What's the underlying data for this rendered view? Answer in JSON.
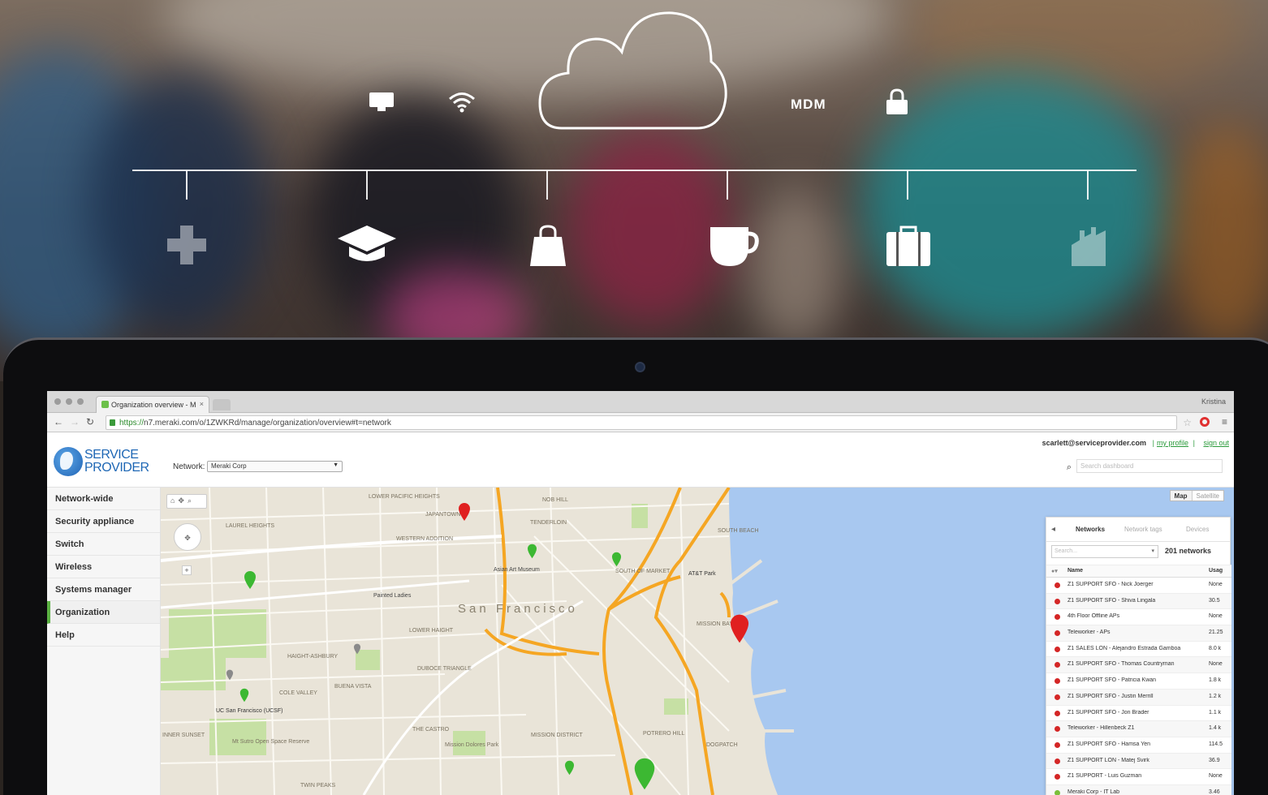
{
  "overlay": {
    "mdm_label": "MDM",
    "icons_top": [
      "monitor-icon",
      "wifi-icon",
      "cloud-icon",
      "mdm-label",
      "lock-icon"
    ],
    "icons_bottom": [
      "medical-cross-icon",
      "graduation-cap-icon",
      "shopping-bag-icon",
      "coffee-cup-icon",
      "briefcase-icon",
      "factory-icon"
    ]
  },
  "browser": {
    "tab_title": "Organization overview - M",
    "tab_close": "×",
    "window_user": "Kristina",
    "url_scheme": "https://",
    "url_rest": "n7.meraki.com/o/1ZWKRd/manage/organization/overview#t=network"
  },
  "app": {
    "brand_line1": "SERVICE",
    "brand_line2": "PROVIDER",
    "network_label": "Network:",
    "network_value": "Meraki Corp",
    "user_email": "scarlett@serviceprovider.com",
    "my_profile": "my profile",
    "sign_out": "sign out",
    "search_placeholder": "Search dashboard"
  },
  "nav": {
    "items": [
      "Network-wide",
      "Security appliance",
      "Switch",
      "Wireless",
      "Systems manager",
      "Organization",
      "Help"
    ],
    "active": "Organization"
  },
  "map": {
    "map_btn": "Map",
    "satellite_btn": "Satellite",
    "city_label": "San Francisco",
    "labels": {
      "lower_pacific_heights": "LOWER PACIFIC HEIGHTS",
      "japantown": "JAPANTOWN",
      "tenderloin": "TENDERLOIN",
      "laurel_heights": "LAUREL HEIGHTS",
      "western_addition": "WESTERN ADDITION",
      "south_of_market": "SOUTH OF MARKET",
      "att_park": "AT&T Park",
      "mission_bay": "MISSION BAY",
      "haight_ashbury": "HAIGHT-ASHBURY",
      "duboce_triangle": "DUBOCE TRIANGLE",
      "cole_valley": "COLE VALLEY",
      "buena_vista": "BUENA VISTA",
      "ucsf": "UC San Francisco (UCSF)",
      "the_castro": "THE CASTRO",
      "mission_district": "MISSION DISTRICT",
      "mission_dolores_park": "Mission Dolores Park",
      "potrero_hill": "POTRERO HILL",
      "dogpatch": "DOGPATCH",
      "inner_sunset": "INNER SUNSET",
      "twin_peaks": "TWIN PEAKS",
      "mt_sutro": "Mt Sutro Open Space Reserve",
      "asian_art_museum": "Asian Art Museum",
      "painted_ladies": "Painted Ladies",
      "lower_haight": "LOWER HAIGHT",
      "south_beach": "SOUTH BEACH",
      "nob_hill": "NOB HILL"
    }
  },
  "panel": {
    "tabs": [
      "Networks",
      "Network tags",
      "Devices"
    ],
    "active_tab": "Networks",
    "search_placeholder": "Search...",
    "count": "201 networks",
    "col_name": "Name",
    "col_usage": "Usag",
    "rows": [
      {
        "name": "Z1 SUPPORT SFO - Nick Joerger",
        "usage": "None",
        "status": "offline"
      },
      {
        "name": "Z1 SUPPORT SFO - Shiva Lingala",
        "usage": "30.5",
        "status": "offline"
      },
      {
        "name": "4th Floor Offline APs",
        "usage": "None",
        "status": "offline"
      },
      {
        "name": "Teleworker - APs",
        "usage": "21.25",
        "status": "offline"
      },
      {
        "name": "Z1 SALES LON - Alejandro Estrada Gamboa",
        "usage": "8.0 k",
        "status": "offline"
      },
      {
        "name": "Z1 SUPPORT SFO - Thomas Countryman",
        "usage": "None",
        "status": "offline"
      },
      {
        "name": "Z1 SUPPORT SFO - Patricia Kwan",
        "usage": "1.8 k",
        "status": "offline"
      },
      {
        "name": "Z1 SUPPORT SFO - Justin Merrill",
        "usage": "1.2 k",
        "status": "offline"
      },
      {
        "name": "Z1 SUPPORT SFO - Jon Brader",
        "usage": "1.1 k",
        "status": "offline"
      },
      {
        "name": "Teleworker - Hillenbeck Z1",
        "usage": "1.4 k",
        "status": "offline"
      },
      {
        "name": "Z1 SUPPORT SFO - Hamsa Yen",
        "usage": "114.5",
        "status": "offline"
      },
      {
        "name": "Z1 SUPPORT LON - Matej Svirk",
        "usage": "36.9",
        "status": "offline"
      },
      {
        "name": "Z1 SUPPORT - Luis Guzman",
        "usage": "None",
        "status": "offline"
      },
      {
        "name": "Meraki Corp - IT Lab",
        "usage": "3.46",
        "status": "online"
      }
    ]
  },
  "colors": {
    "brand_blue": "#1e67b5",
    "nav_active": "#5bb143",
    "link_green": "#2a9a3a",
    "pin_red": "#e02020",
    "pin_green": "#3cb832",
    "water": "#a8c8f0",
    "highway": "#f5a623"
  }
}
